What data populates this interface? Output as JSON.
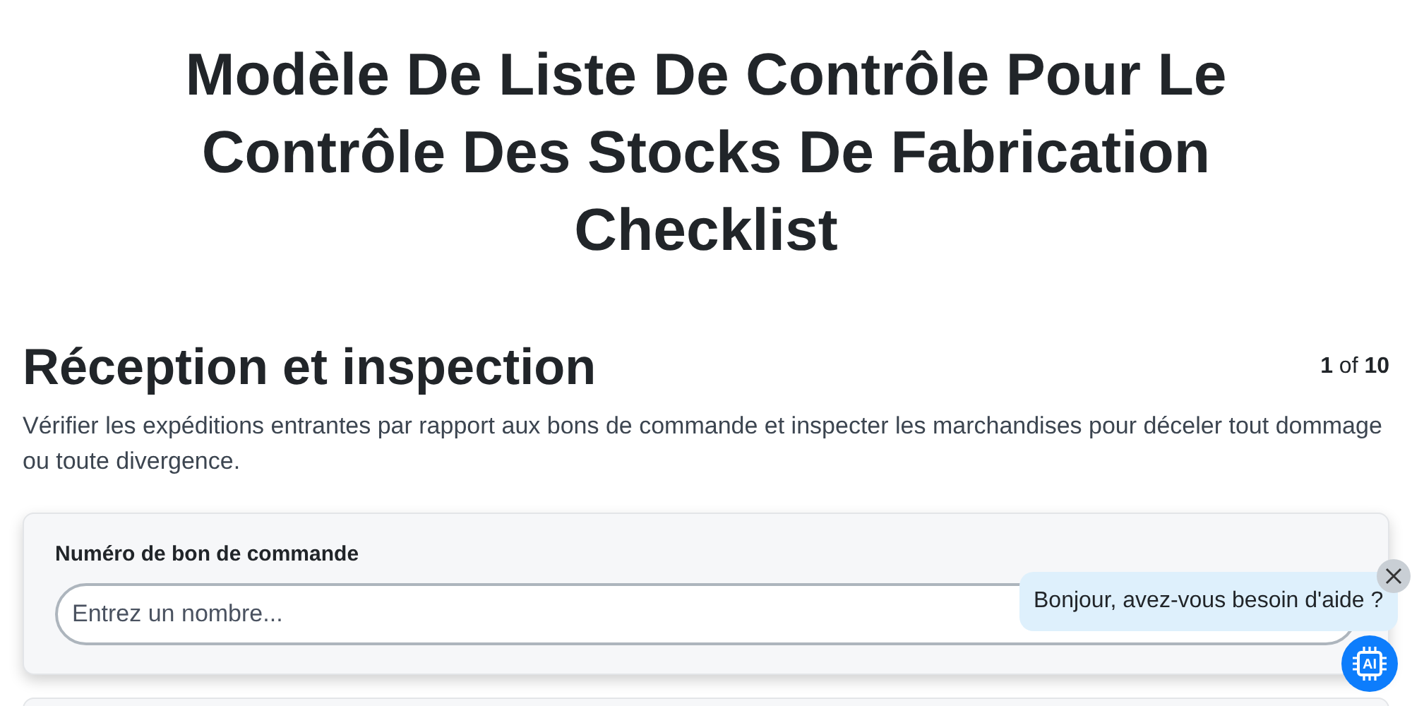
{
  "title": "Modèle De Liste De Contrôle Pour Le Contrôle Des Stocks De Fabrication Checklist",
  "section": {
    "heading": "Réception et inspection",
    "progress": "**1** of **10**",
    "description": "Vérifier les expéditions entrantes par rapport aux bons de commande et inspecter les marchandises pour déceler tout dommage ou toute divergence."
  },
  "fields": [
    {
      "label": "Numéro de bon de commande",
      "placeholder": "Entrez un nombre..."
    }
  ],
  "chat": {
    "message": "Bonjour, avez-vous besoin d'aide ?",
    "button": "AI"
  }
}
